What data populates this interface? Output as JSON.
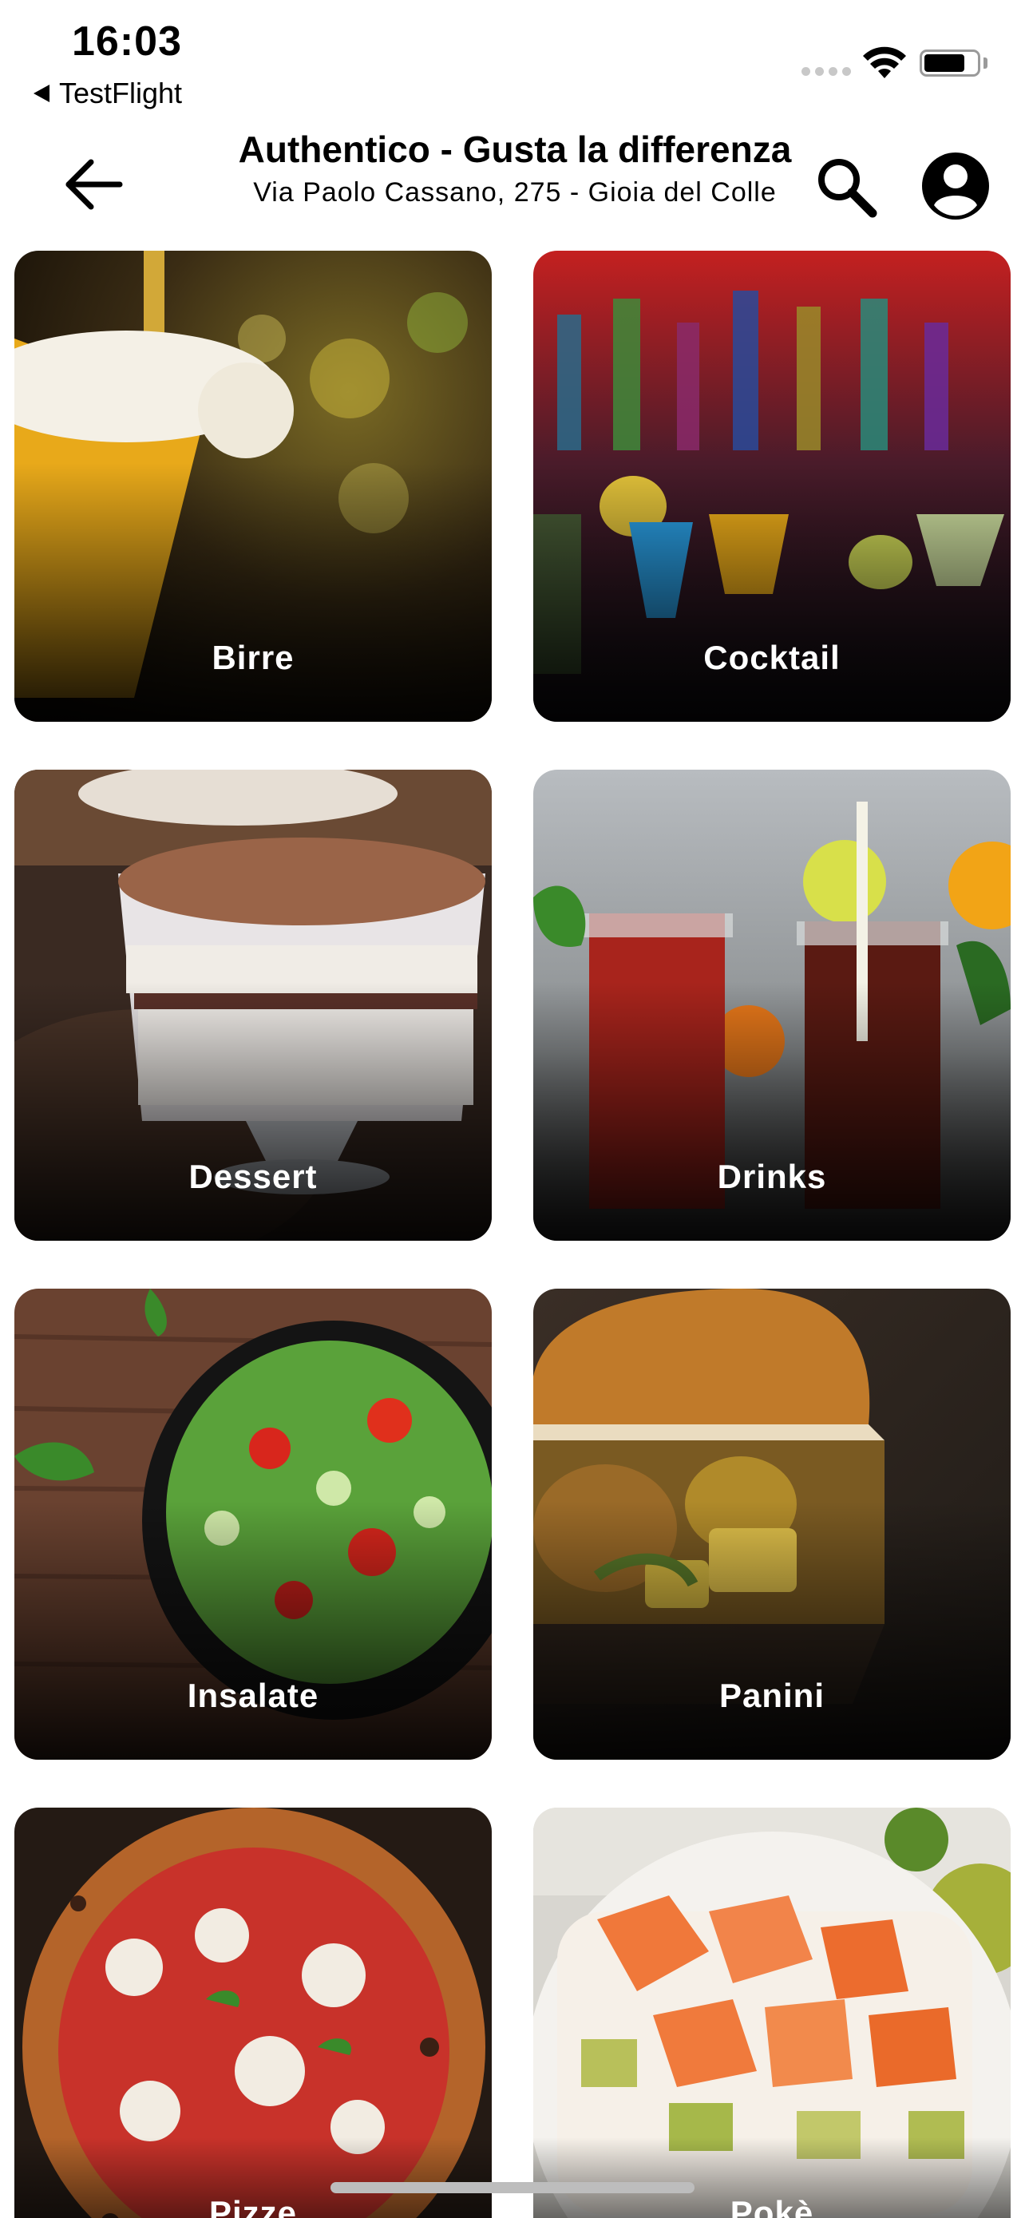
{
  "status_bar": {
    "time": "16:03",
    "back_app": "TestFlight"
  },
  "header": {
    "title": "Authentico - Gusta la differenza",
    "subtitle": "Via Paolo Cassano, 275 - Gioia del Colle",
    "icons": [
      "arrow-left-icon",
      "search-icon",
      "account-icon"
    ]
  },
  "categories": [
    {
      "label": "Birre",
      "icon": "beer-image"
    },
    {
      "label": "Cocktail",
      "icon": "cocktail-image"
    },
    {
      "label": "Dessert",
      "icon": "dessert-image"
    },
    {
      "label": "Drinks",
      "icon": "drinks-image"
    },
    {
      "label": "Insalate",
      "icon": "salad-image"
    },
    {
      "label": "Panini",
      "icon": "sandwich-image"
    },
    {
      "label": "Pizze",
      "icon": "pizza-image"
    },
    {
      "label": "Pokè",
      "icon": "poke-image"
    }
  ],
  "colors": {
    "background": "#ffffff",
    "text": "#000000",
    "card_label": "#ffffff"
  }
}
